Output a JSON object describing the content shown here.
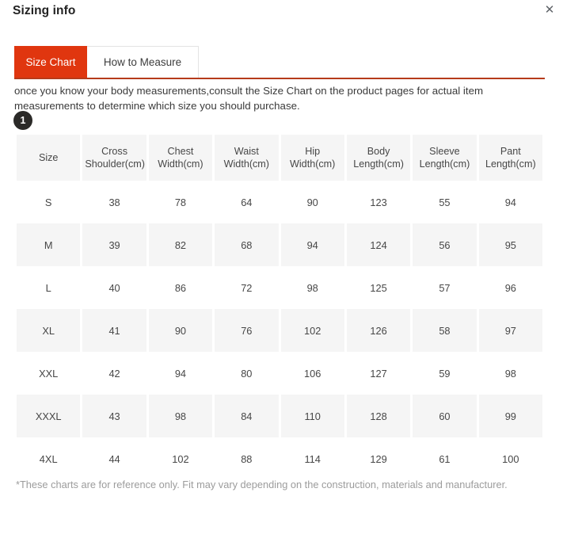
{
  "modal": {
    "title": "Sizing info",
    "close_icon": "close-icon",
    "close_glyph": "✕"
  },
  "tabs": [
    {
      "label": "Size Chart",
      "active": true
    },
    {
      "label": "How to Measure",
      "active": false
    }
  ],
  "description": "once you know your body measurements,consult the Size Chart on the product pages for actual item measurements to determine which size you should purchase.",
  "step_badge": "1",
  "footer_note": "*These charts are for reference only. Fit may vary depending on the construction, materials and manufacturer.",
  "colors": {
    "tab_active_bg": "#e0360f",
    "tab_underline": "#b63b1b",
    "row_shaded_bg": "#f5f5f5",
    "badge_bg": "#2b2a28",
    "text": "#474747",
    "note_text": "#9c9c9c"
  },
  "chart_data": {
    "type": "table",
    "title": "Size Chart",
    "columns": [
      "Size",
      "Cross Shoulder(cm)",
      "Chest Width(cm)",
      "Waist Width(cm)",
      "Hip Width(cm)",
      "Body Length(cm)",
      "Sleeve Length(cm)",
      "Pant Length(cm)"
    ],
    "column_lines": [
      [
        "Size"
      ],
      [
        "Cross",
        "Shoulder(cm)"
      ],
      [
        "Chest",
        "Width(cm)"
      ],
      [
        "Waist",
        "Width(cm)"
      ],
      [
        "Hip",
        "Width(cm)"
      ],
      [
        "Body",
        "Length(cm)"
      ],
      [
        "Sleeve",
        "Length(cm)"
      ],
      [
        "Pant",
        "Length(cm)"
      ]
    ],
    "rows": [
      {
        "cells": [
          "S",
          "38",
          "78",
          "64",
          "90",
          "123",
          "55",
          "94"
        ],
        "shaded": false
      },
      {
        "cells": [
          "M",
          "39",
          "82",
          "68",
          "94",
          "124",
          "56",
          "95"
        ],
        "shaded": true
      },
      {
        "cells": [
          "L",
          "40",
          "86",
          "72",
          "98",
          "125",
          "57",
          "96"
        ],
        "shaded": false
      },
      {
        "cells": [
          "XL",
          "41",
          "90",
          "76",
          "102",
          "126",
          "58",
          "97"
        ],
        "shaded": true
      },
      {
        "cells": [
          "XXL",
          "42",
          "94",
          "80",
          "106",
          "127",
          "59",
          "98"
        ],
        "shaded": false
      },
      {
        "cells": [
          "XXXL",
          "43",
          "98",
          "84",
          "110",
          "128",
          "60",
          "99"
        ],
        "shaded": true
      },
      {
        "cells": [
          "4XL",
          "44",
          "102",
          "88",
          "114",
          "129",
          "61",
          "100"
        ],
        "shaded": false
      }
    ]
  }
}
